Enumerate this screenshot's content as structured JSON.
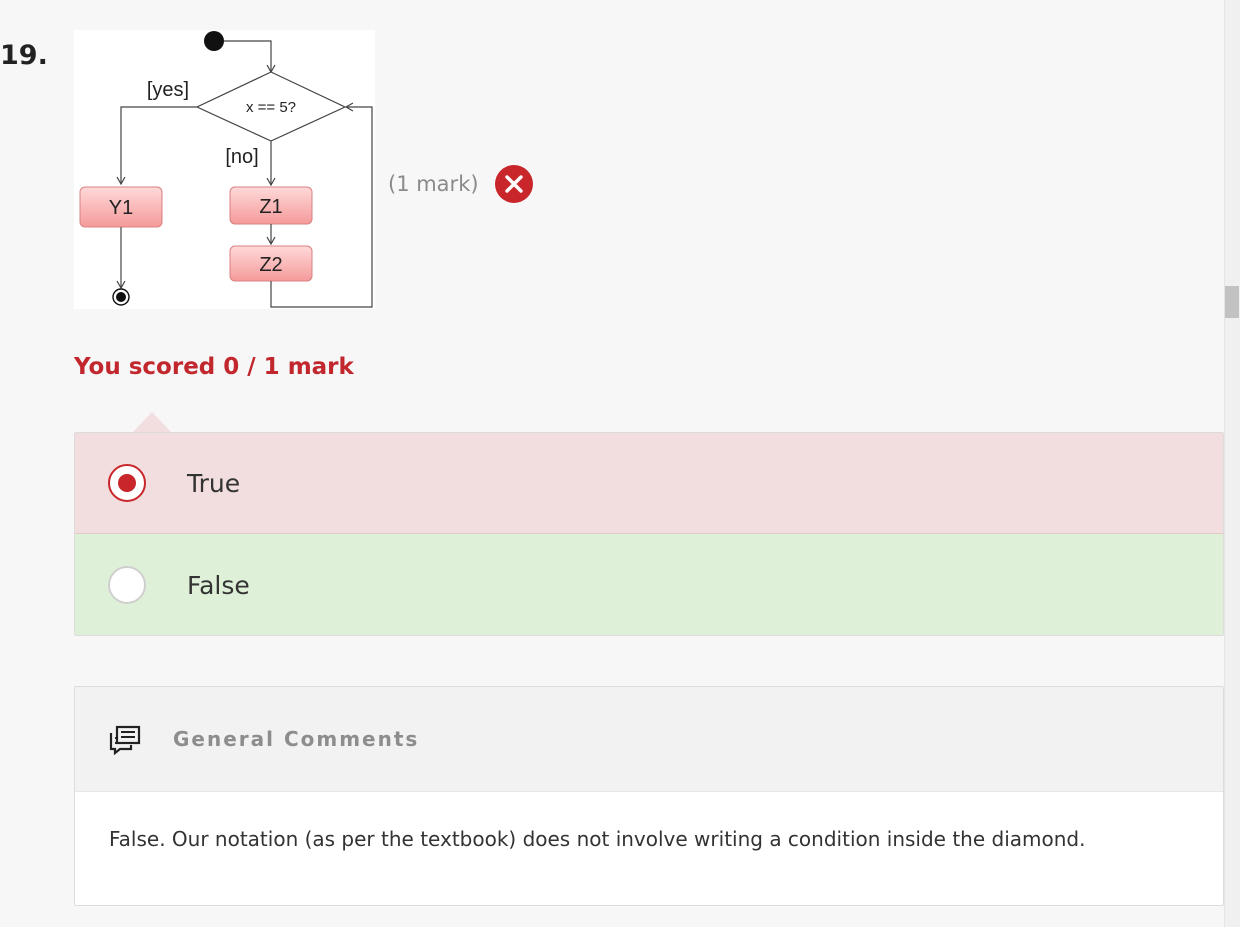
{
  "question": {
    "number": "19.",
    "marks": "(1 mark)",
    "result_icon": "x-circle-icon"
  },
  "diagram": {
    "condition": "x == 5?",
    "yes_label": "[yes]",
    "no_label": "[no]",
    "nodes": [
      "Y1",
      "Z1",
      "Z2"
    ]
  },
  "score": {
    "text": "You scored 0 / 1 mark",
    "color": "#c1272d"
  },
  "options": [
    {
      "label": "True",
      "selected": true,
      "state": "incorrect",
      "background": "#f2dede"
    },
    {
      "label": "False",
      "selected": false,
      "state": "correct",
      "background": "#dff0d8"
    }
  ],
  "comments": {
    "icon": "comments-icon",
    "title": "General Comments",
    "body": "False. Our notation (as per the textbook) does not involve writing a condition inside the diamond."
  }
}
